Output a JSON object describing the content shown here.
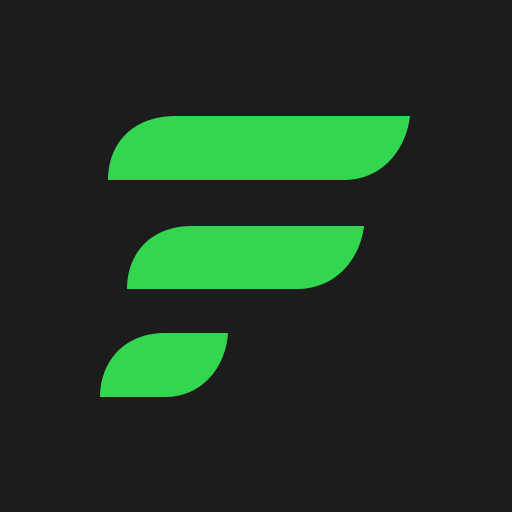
{
  "icon": {
    "name": "f-logo-icon",
    "background_color": "#1c1c1d",
    "mark_color": "#33d64f",
    "stripe_count": 3
  }
}
